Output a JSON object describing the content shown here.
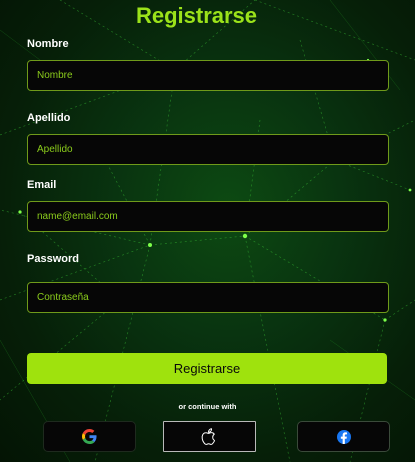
{
  "title": "Registrarse",
  "fields": {
    "nombre": {
      "label": "Nombre",
      "placeholder": "Nombre"
    },
    "apellido": {
      "label": "Apellido",
      "placeholder": "Apellido"
    },
    "email": {
      "label": "Email",
      "placeholder": "name@email.com"
    },
    "password": {
      "label": "Password",
      "placeholder": "Contraseña"
    }
  },
  "submit_label": "Registrarse",
  "continue_text": "or continue with",
  "social": [
    {
      "name": "google",
      "icon": "google-icon"
    },
    {
      "name": "apple",
      "icon": "apple-icon"
    },
    {
      "name": "facebook",
      "icon": "facebook-icon"
    }
  ],
  "colors": {
    "accent": "#9fe20d",
    "background": "#093410",
    "input_bg": "#060606",
    "input_border": "#6f9a1a",
    "facebook": "#1877f2"
  }
}
